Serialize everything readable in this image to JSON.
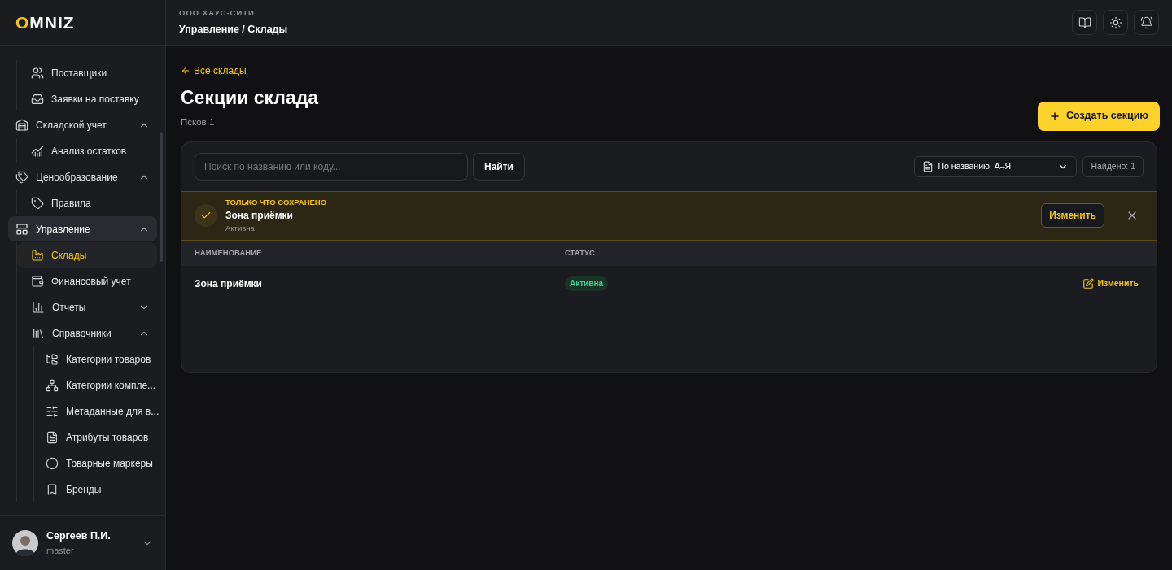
{
  "logo": {
    "accent": "O",
    "rest": "MNIZ"
  },
  "sidebar": {
    "items": [
      {
        "kind": "group",
        "children": [
          {
            "kind": "item",
            "label": "Поставщики",
            "selected": false
          },
          {
            "kind": "item",
            "label": "Заявки на поставку",
            "selected": false
          }
        ]
      },
      {
        "kind": "group",
        "label": "Складской учет",
        "expanded": true,
        "selected": false,
        "children": [
          {
            "kind": "item",
            "label": "Анализ остатков",
            "selected": false
          }
        ]
      },
      {
        "kind": "group",
        "label": "Ценообразование",
        "expanded": true,
        "selected": false,
        "children": [
          {
            "kind": "item",
            "label": "Правила",
            "selected": false
          }
        ]
      },
      {
        "kind": "group",
        "label": "Управление",
        "expanded": true,
        "selected": true,
        "children": [
          {
            "kind": "item",
            "label": "Склады",
            "selected": true
          },
          {
            "kind": "item",
            "label": "Финансовый учет",
            "selected": false
          },
          {
            "kind": "group",
            "label": "Отчеты",
            "expanded": false,
            "selected": false
          },
          {
            "kind": "group",
            "label": "Справочники",
            "expanded": true,
            "selected": false,
            "children": [
              {
                "kind": "item",
                "label": "Категории товаров",
                "selected": false
              },
              {
                "kind": "item",
                "label": "Категории компле...",
                "selected": false
              },
              {
                "kind": "item",
                "label": "Метаданные для в...",
                "selected": false
              },
              {
                "kind": "item",
                "label": "Атрибуты товаров",
                "selected": false
              },
              {
                "kind": "item",
                "label": "Товарные маркеры",
                "selected": false
              },
              {
                "kind": "item",
                "label": "Бренды",
                "selected": false
              }
            ]
          }
        ]
      }
    ]
  },
  "user": {
    "name": "Сергеев П.И.",
    "role": "master"
  },
  "header": {
    "org": "ООО ХАУС-СИТИ",
    "breadcrumb": "Управление / Склады"
  },
  "back_link": "Все склады",
  "title": "Секции склада",
  "subtitle": "Псков 1",
  "create_button": "Создать секцию",
  "search": {
    "placeholder": "Поиск по названию или коду...",
    "button": "Найти"
  },
  "sort": {
    "value": "По названию: А–Я"
  },
  "found": "Найдено: 1",
  "notice": {
    "caption": "ТОЛЬКО ЧТО СОХРАНЕНО",
    "name": "Зона приёмки",
    "status": "Активна",
    "button": "Изменить"
  },
  "table": {
    "columns": [
      "НАИМЕНОВАНИЕ",
      "СТАТУС"
    ],
    "rows": [
      {
        "name": "Зона приёмки",
        "status": "Активна",
        "action": "Изменить"
      }
    ]
  }
}
